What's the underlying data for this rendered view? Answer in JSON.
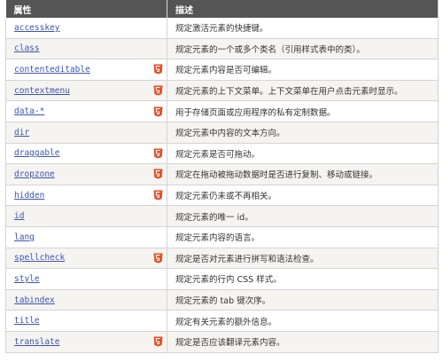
{
  "table": {
    "header": {
      "attribute": "属性",
      "description": "描述"
    },
    "rows": [
      {
        "attr": "accesskey",
        "html5": false,
        "desc": "规定激活元素的快捷键。"
      },
      {
        "attr": "class",
        "html5": false,
        "desc": "规定元素的一个或多个类名（引用样式表中的类）。"
      },
      {
        "attr": "contenteditable",
        "html5": true,
        "desc": "规定元素内容是否可编辑。"
      },
      {
        "attr": "contextmenu",
        "html5": true,
        "desc": "规定元素的上下文菜单。上下文菜单在用户点击元素时显示。"
      },
      {
        "attr": "data-*",
        "html5": true,
        "desc": "用于存储页面或应用程序的私有定制数据。"
      },
      {
        "attr": "dir",
        "html5": false,
        "desc": "规定元素中内容的文本方向。"
      },
      {
        "attr": "draggable",
        "html5": true,
        "desc": "规定元素是否可拖动。"
      },
      {
        "attr": "dropzone",
        "html5": true,
        "desc": "规定在拖动被拖动数据时是否进行复制、移动或链接。"
      },
      {
        "attr": "hidden",
        "html5": true,
        "desc": "规定元素仍未或不再相关。"
      },
      {
        "attr": "id",
        "html5": false,
        "desc": "规定元素的唯一 id。"
      },
      {
        "attr": "lang",
        "html5": false,
        "desc": "规定元素内容的语言。"
      },
      {
        "attr": "spellcheck",
        "html5": true,
        "desc": "规定是否对元素进行拼写和语法检查。"
      },
      {
        "attr": "style",
        "html5": false,
        "desc": "规定元素的行内 CSS 样式。"
      },
      {
        "attr": "tabindex",
        "html5": false,
        "desc": "规定元素的 tab 键次序。"
      },
      {
        "attr": "title",
        "html5": false,
        "desc": "规定有关元素的额外信息。"
      },
      {
        "attr": "translate",
        "html5": true,
        "desc": "规定是否应该翻译元素内容。"
      }
    ]
  },
  "badge": {
    "icon": "html5-icon",
    "color": "#e44d26"
  }
}
